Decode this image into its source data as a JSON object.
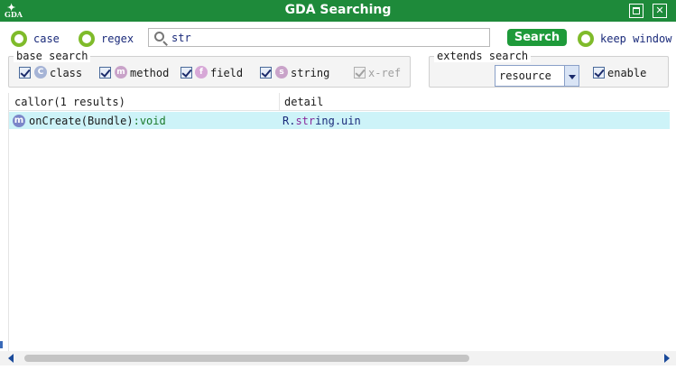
{
  "window": {
    "title": "GDA Searching",
    "logo_text": "GDA"
  },
  "options": {
    "case_label": "case",
    "regex_label": "regex",
    "keep_window_label": "keep window"
  },
  "search": {
    "value": "str",
    "button_label": "Search"
  },
  "base_search": {
    "title": "base search",
    "items": [
      {
        "label": "class",
        "badge": "C",
        "badge_color": "#a6b4d6",
        "checked": true
      },
      {
        "label": "method",
        "badge": "m",
        "badge_color": "#c9a3c9",
        "checked": true
      },
      {
        "label": "field",
        "badge": "f",
        "badge_color": "#d7a8d7",
        "checked": true
      },
      {
        "label": "string",
        "badge": "s",
        "badge_color": "#c9a3c9",
        "checked": true
      },
      {
        "label": "x-ref",
        "checked": true,
        "disabled": true
      }
    ]
  },
  "extends_search": {
    "title": "extends search",
    "selected": "resource",
    "enable_label": "enable"
  },
  "results": {
    "columns": [
      "callor(1 results)",
      "detail"
    ],
    "rows": [
      {
        "badge": "m",
        "name": "onCreate(Bundle)",
        "type": ":void",
        "detail_prefix": "R.",
        "detail_hit": "str",
        "detail_suffix": "ing.uin"
      }
    ]
  }
}
